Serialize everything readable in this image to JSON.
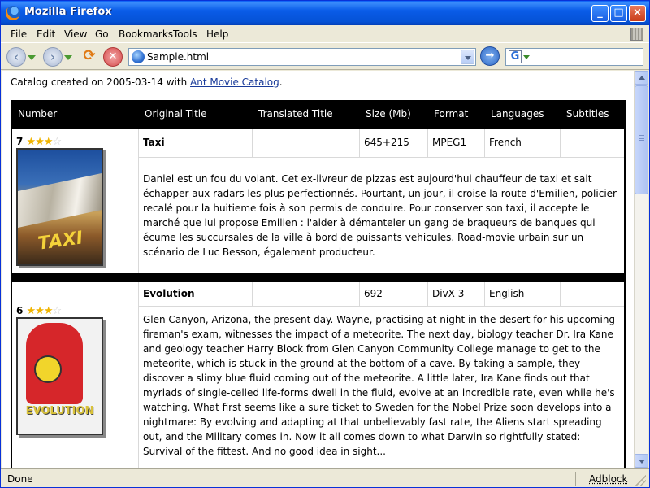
{
  "window": {
    "title": "Mozilla Firefox"
  },
  "menu": [
    "File",
    "Edit",
    "View",
    "Go",
    "Bookmarks",
    "Tools",
    "Help"
  ],
  "toolbar": {
    "url": "Sample.html",
    "search_engine_letter": "G"
  },
  "page": {
    "catalog_prefix": "Catalog created on 2005-03-14 with ",
    "catalog_link": "Ant Movie Catalog",
    "catalog_suffix": ".",
    "columns": [
      "Number",
      "Original Title",
      "Translated Title",
      "Size (Mb)",
      "Format",
      "Languages",
      "Subtitles"
    ],
    "movies": [
      {
        "number": "7",
        "rating": 3,
        "rating_max": 4,
        "original_title": "Taxi",
        "translated_title": "",
        "size": "645+215",
        "format": "MPEG1",
        "languages": "French",
        "subtitles": "",
        "poster_label": "TAXI",
        "description": "Daniel est un fou du volant. Cet ex-livreur de pizzas est aujourd'hui chauffeur de taxi et sait échapper aux radars les plus perfectionnés. Pourtant, un jour, il croise la route d'Emilien, policier recalé pour la huitieme fois à son permis de conduire. Pour conserver son taxi, il accepte le marché que lui propose Emilien : l'aider à démanteler un gang de braqueurs de banques qui écume les succursales de la ville à bord de puissants vehicules. Road-movie urbain sur un scénario de Luc Besson, également producteur."
      },
      {
        "number": "6",
        "rating": 3,
        "rating_max": 4,
        "original_title": "Evolution",
        "translated_title": "",
        "size": "692",
        "format": "DivX 3",
        "languages": "English",
        "subtitles": "",
        "poster_label": "EVOLUTION",
        "description": "Glen Canyon, Arizona, the present day. Wayne, practising at night in the desert for his upcoming fireman's exam, witnesses the impact of a meteorite. The next day, biology teacher Dr. Ira Kane and geology teacher Harry Block from Glen Canyon Community College manage to get to the meteorite, which is stuck in the ground at the bottom of a cave. By taking a sample, they discover a slimy blue fluid coming out of the meteorite. A little later, Ira Kane finds out that myriads of single-celled life-forms dwell in the fluid, evolve at an incredible rate, even while he's watching. What first seems like a sure ticket to Sweden for the Nobel Prize soon develops into a nightmare: By evolving and adapting at that unbelievably fast rate, the Aliens start spreading out, and the Military comes in. Now it all comes down to what Darwin so rightfully stated: Survival of the fittest. And no good idea in sight..."
      }
    ]
  },
  "status": {
    "text": "Done",
    "adblock": "Adblock"
  }
}
